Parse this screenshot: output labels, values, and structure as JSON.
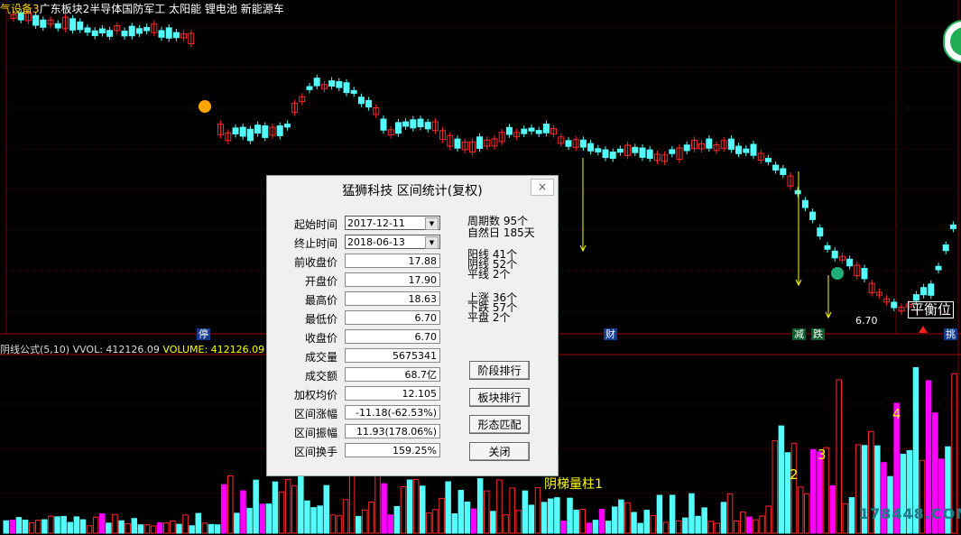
{
  "header": {
    "sectors_prefix": "气设备3",
    "sectors": "广东板块2半导体国防军工 太阳能 锂电池 新能源车"
  },
  "indicator_bar": {
    "formula": "阴线公式(5,10)",
    "vol_label": "VVOL: 412126.09",
    "volume_label": "VOLUME: 412126.09"
  },
  "markers": {
    "ting": "停",
    "cai": "财",
    "jian": "减",
    "die": "跌",
    "tiao": "挑"
  },
  "price_label": "6.70",
  "balance_label": "平衡位",
  "yin_label": "阴梯量柱1",
  "volume_numbers": [
    "2",
    "3",
    "4",
    "3",
    "3"
  ],
  "watermark": "178448.COM",
  "dialog": {
    "title": "猛狮科技 区间统计(复权)",
    "close": "×",
    "fields": [
      {
        "label": "起始时间",
        "value": "2017-12-11",
        "select": true
      },
      {
        "label": "终止时间",
        "value": "2018-06-13",
        "select": true
      },
      {
        "label": "前收盘价",
        "value": "17.88"
      },
      {
        "label": "开盘价",
        "value": "17.90"
      },
      {
        "label": "最高价",
        "value": "18.63"
      },
      {
        "label": "最低价",
        "value": "6.70"
      },
      {
        "label": "收盘价",
        "value": "6.70"
      },
      {
        "label": "成交量",
        "value": "5675341"
      },
      {
        "label": "成交额",
        "value": "68.7亿"
      },
      {
        "label": "加权均价",
        "value": "12.105"
      },
      {
        "label": "区间涨幅",
        "value": "-11.18(-62.53%)"
      },
      {
        "label": "区间振幅",
        "value": "11.93(178.06%)"
      },
      {
        "label": "区间换手",
        "value": "159.25%"
      }
    ],
    "stats": {
      "periods": "周期数 95个",
      "natural_days": "自然日 185天",
      "yang": "阳线 41个",
      "yin": "阴线 52个",
      "flat": "平线 2个",
      "up": "上涨 36个",
      "down": "下跌 57个",
      "flat_close": "平盘 2个"
    },
    "buttons": [
      "阶段排行",
      "板块排行",
      "形态匹配",
      "关闭"
    ]
  },
  "colors": {
    "up": "#ff2a2a",
    "down": "#54fcfc",
    "magenta": "#ff00ff",
    "grid": "#7a0000",
    "yellow": "#ffff00"
  }
}
